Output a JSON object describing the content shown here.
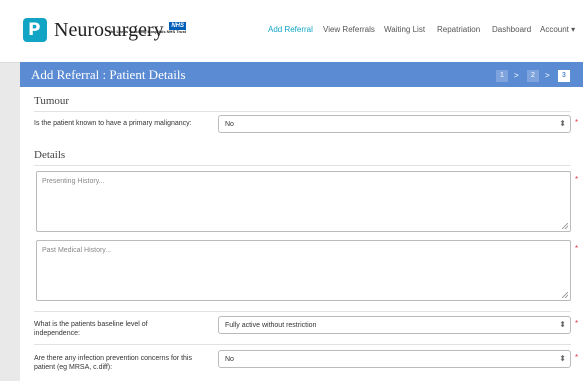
{
  "brand": {
    "logo_glyph": "P",
    "title": "Neurosurgery",
    "nhs_badge": "NHS",
    "nhs_trust": "The Leeds Teaching Hospitals NHS Trust",
    "color": "#11a4c4"
  },
  "nav": [
    {
      "label": "Add Referral",
      "active": true
    },
    {
      "label": "View Referrals",
      "active": false
    },
    {
      "label": "Waiting List",
      "active": false
    },
    {
      "label": "Repatriation",
      "active": false
    },
    {
      "label": "Dashboard",
      "active": false
    },
    {
      "label": "Account ▾",
      "active": false
    }
  ],
  "panel": {
    "title": "Add Referral : Patient Details",
    "header_color": "#5b8bd3",
    "steps": [
      "1",
      "2",
      "3"
    ],
    "step_separator": ">",
    "current_step": "3"
  },
  "tumour": {
    "section_title": "Tumour",
    "primary_malignancy": {
      "label": "Is the patient known to have a primary malignancy:",
      "value": "No",
      "required": "*"
    }
  },
  "details": {
    "section_title": "Details",
    "presenting_history": {
      "placeholder": "Presenting History...",
      "required": "*"
    },
    "past_medical_history": {
      "placeholder": "Past Medical History...",
      "required": "*"
    },
    "baseline_independence": {
      "label_line1": "What is the patients baseline level of",
      "label_line2": "independence:",
      "value": "Fully active without restriction",
      "required": "*"
    },
    "infection_prevention": {
      "label_line1": "Are there any infection prevention concerns for this",
      "label_line2": "patient (eg MRSA, c.diff):",
      "value": "No",
      "required": "*"
    }
  },
  "icons": {
    "select_arrow": "⬍"
  }
}
